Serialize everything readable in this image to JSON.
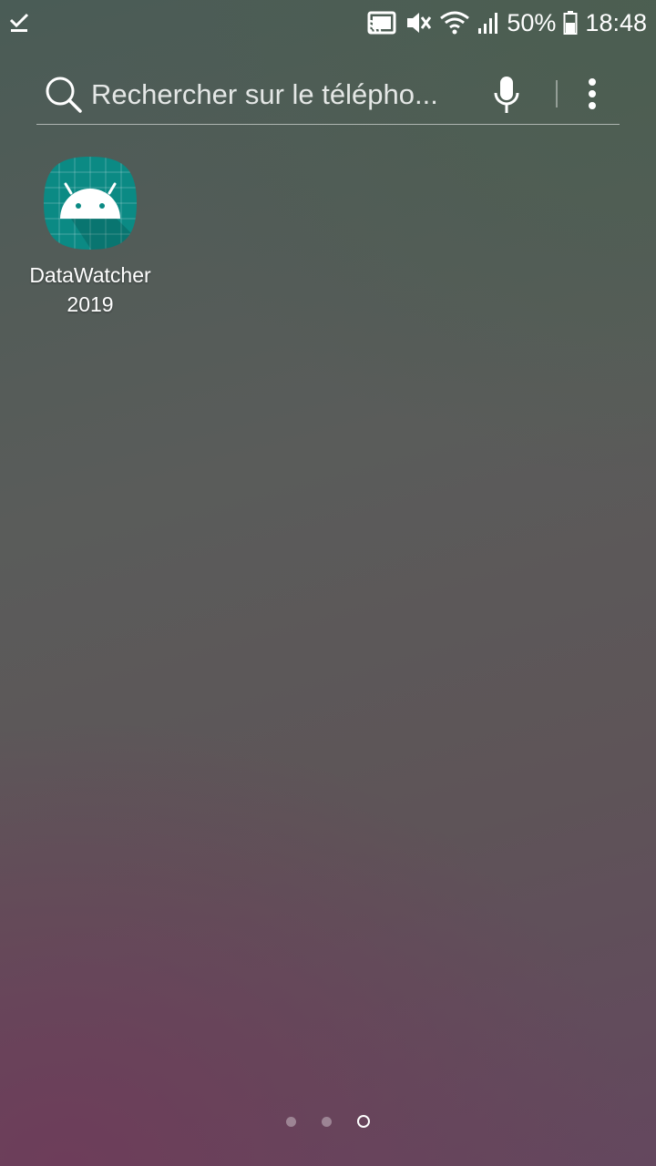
{
  "status_bar": {
    "battery_percent": "50%",
    "time": "18:48",
    "icons": [
      "check-icon",
      "cast-icon",
      "mute-icon",
      "wifi-icon",
      "signal-icon",
      "battery-icon"
    ]
  },
  "search": {
    "placeholder": "Rechercher sur le télépho..."
  },
  "apps": [
    {
      "label": "DataWatcher 2019",
      "icon": "android-icon"
    }
  ],
  "page_indicator": {
    "count": 3,
    "active_index": 2
  },
  "colors": {
    "app_icon_bg": "#0b8a84",
    "text": "#ffffff"
  }
}
